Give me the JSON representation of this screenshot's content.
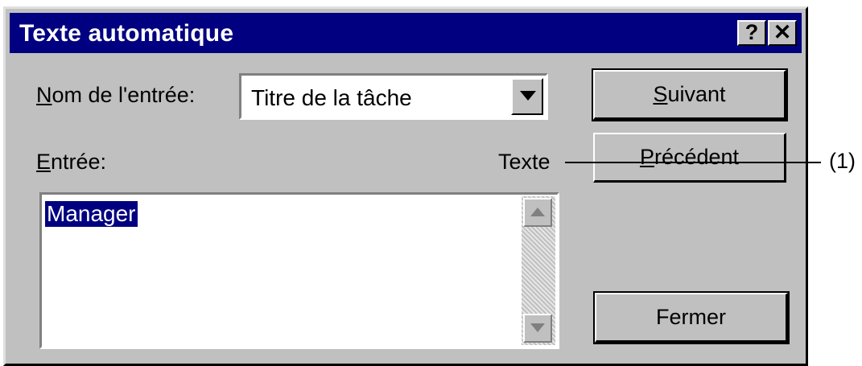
{
  "window": {
    "title": "Texte automatique",
    "help_button": "?",
    "close_button": "✕"
  },
  "form": {
    "entry_name_label_accel": "N",
    "entry_name_label_rest": "om de l'entrée:",
    "entry_name_value": "Titre de la tâche",
    "entry_label_accel": "E",
    "entry_label_rest": "ntrée:",
    "entry_type": "Texte",
    "entries": [
      "Manager"
    ]
  },
  "buttons": {
    "next_accel": "S",
    "next_rest": "uivant",
    "previous_accel": "P",
    "previous_rest": "récédent",
    "close": "Fermer"
  },
  "annotation": {
    "callout": "(1)"
  },
  "icons": {
    "dropdown": "chevron-down-icon",
    "scroll_up": "arrow-up-icon",
    "scroll_down": "arrow-down-icon"
  }
}
